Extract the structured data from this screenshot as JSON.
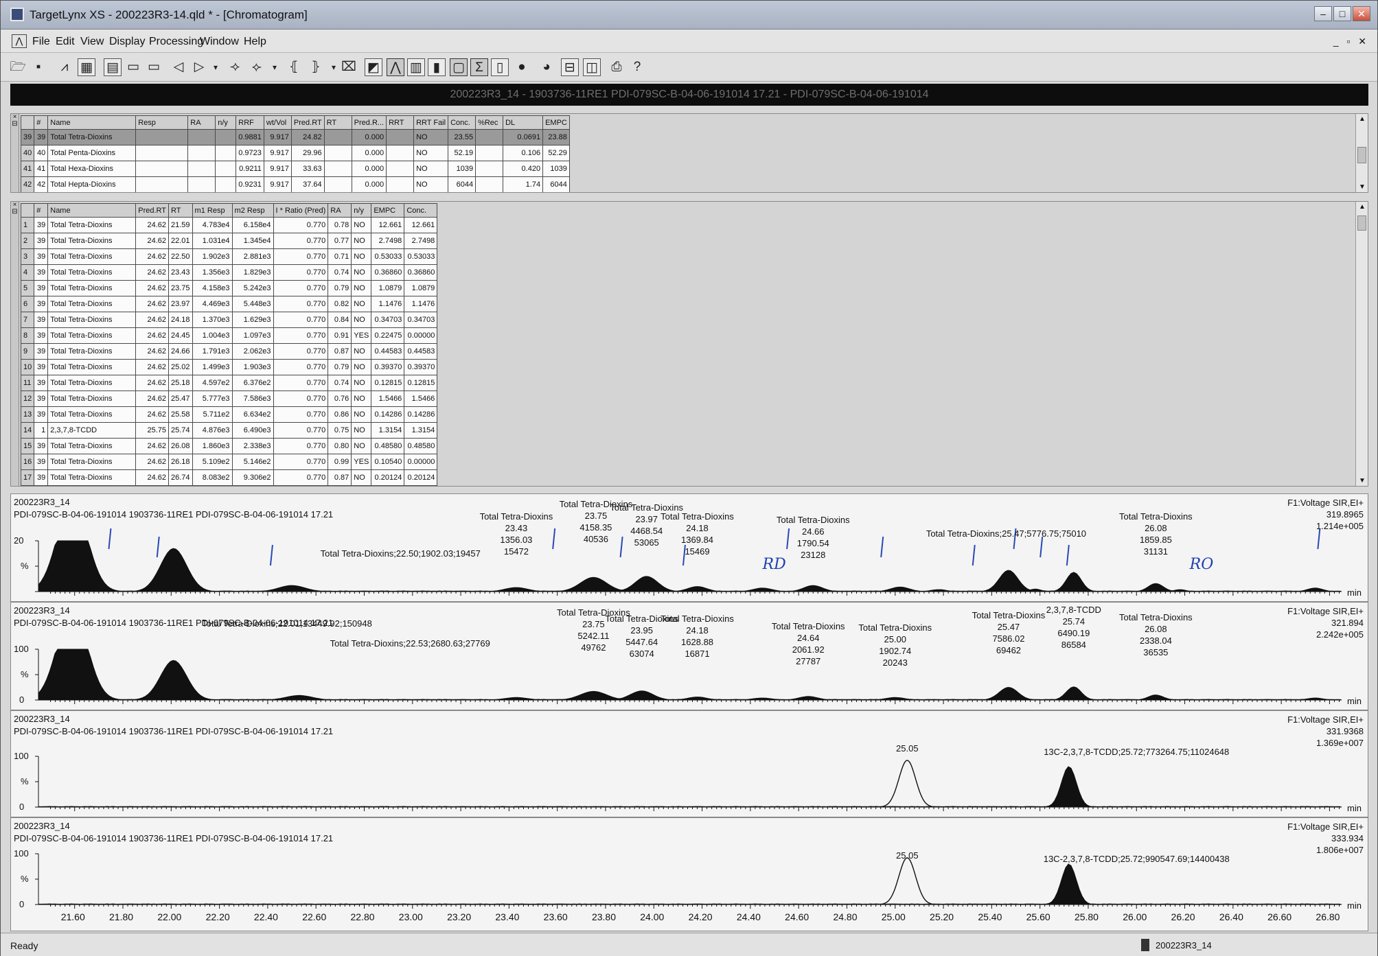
{
  "window": {
    "title": "TargetLynx XS - 200223R3-14.qld * - [Chromatogram]",
    "sample_header": "200223R3_14 - 1903736-11RE1 PDI-079SC-B-04-06-191014 17.21 - PDI-079SC-B-04-06-191014"
  },
  "menu": [
    "File",
    "Edit",
    "View",
    "Display",
    "Processing",
    "Window",
    "Help"
  ],
  "compound_table": {
    "columns": [
      "#",
      "Name",
      "Resp",
      "RA",
      "n/y",
      "RRF",
      "wt/Vol",
      "Pred.RT",
      "RT",
      "Pred.R...",
      "RRT",
      "RRT Fail",
      "Conc.",
      "%Rec",
      "DL",
      "EMPC"
    ],
    "rows": [
      {
        "rn": "39",
        "cells": [
          "39",
          "Total Tetra-Dioxins",
          "",
          "",
          "",
          "0.9881",
          "9.917",
          "24.82",
          "",
          "0.000",
          "",
          "NO",
          "23.55",
          "",
          "0.0691",
          "23.88"
        ]
      },
      {
        "rn": "40",
        "cells": [
          "40",
          "Total Penta-Dioxins",
          "",
          "",
          "",
          "0.9723",
          "9.917",
          "29.96",
          "",
          "0.000",
          "",
          "NO",
          "52.19",
          "",
          "0.106",
          "52.29"
        ]
      },
      {
        "rn": "41",
        "cells": [
          "41",
          "Total Hexa-Dioxins",
          "",
          "",
          "",
          "0.9211",
          "9.917",
          "33.63",
          "",
          "0.000",
          "",
          "NO",
          "1039",
          "",
          "0.420",
          "1039"
        ]
      },
      {
        "rn": "42",
        "cells": [
          "42",
          "Total Hepta-Dioxins",
          "",
          "",
          "",
          "0.9231",
          "9.917",
          "37.64",
          "",
          "0.000",
          "",
          "NO",
          "6044",
          "",
          "1.74",
          "6044"
        ]
      }
    ]
  },
  "peak_table": {
    "columns": [
      "#",
      "Name",
      "Pred.RT",
      "RT",
      "m1 Resp",
      "m2 Resp",
      "I * Ratio (Pred)",
      "RA",
      "n/y",
      "EMPC",
      "Conc."
    ],
    "rows": [
      {
        "rn": "1",
        "cells": [
          "39",
          "Total Tetra-Dioxins",
          "24.62",
          "21.59",
          "4.783e4",
          "6.158e4",
          "0.770",
          "0.78",
          "NO",
          "12.661",
          "12.661"
        ]
      },
      {
        "rn": "2",
        "cells": [
          "39",
          "Total Tetra-Dioxins",
          "24.62",
          "22.01",
          "1.031e4",
          "1.345e4",
          "0.770",
          "0.77",
          "NO",
          "2.7498",
          "2.7498"
        ]
      },
      {
        "rn": "3",
        "cells": [
          "39",
          "Total Tetra-Dioxins",
          "24.62",
          "22.50",
          "1.902e3",
          "2.881e3",
          "0.770",
          "0.71",
          "NO",
          "0.53033",
          "0.53033"
        ]
      },
      {
        "rn": "4",
        "cells": [
          "39",
          "Total Tetra-Dioxins",
          "24.62",
          "23.43",
          "1.356e3",
          "1.829e3",
          "0.770",
          "0.74",
          "NO",
          "0.36860",
          "0.36860"
        ]
      },
      {
        "rn": "5",
        "cells": [
          "39",
          "Total Tetra-Dioxins",
          "24.62",
          "23.75",
          "4.158e3",
          "5.242e3",
          "0.770",
          "0.79",
          "NO",
          "1.0879",
          "1.0879"
        ]
      },
      {
        "rn": "6",
        "cells": [
          "39",
          "Total Tetra-Dioxins",
          "24.62",
          "23.97",
          "4.469e3",
          "5.448e3",
          "0.770",
          "0.82",
          "NO",
          "1.1476",
          "1.1476"
        ]
      },
      {
        "rn": "7",
        "cells": [
          "39",
          "Total Tetra-Dioxins",
          "24.62",
          "24.18",
          "1.370e3",
          "1.629e3",
          "0.770",
          "0.84",
          "NO",
          "0.34703",
          "0.34703"
        ]
      },
      {
        "rn": "8",
        "cells": [
          "39",
          "Total Tetra-Dioxins",
          "24.62",
          "24.45",
          "1.004e3",
          "1.097e3",
          "0.770",
          "0.91",
          "YES",
          "0.22475",
          "0.00000"
        ]
      },
      {
        "rn": "9",
        "cells": [
          "39",
          "Total Tetra-Dioxins",
          "24.62",
          "24.66",
          "1.791e3",
          "2.062e3",
          "0.770",
          "0.87",
          "NO",
          "0.44583",
          "0.44583"
        ]
      },
      {
        "rn": "10",
        "cells": [
          "39",
          "Total Tetra-Dioxins",
          "24.62",
          "25.02",
          "1.499e3",
          "1.903e3",
          "0.770",
          "0.79",
          "NO",
          "0.39370",
          "0.39370"
        ]
      },
      {
        "rn": "11",
        "cells": [
          "39",
          "Total Tetra-Dioxins",
          "24.62",
          "25.18",
          "4.597e2",
          "6.376e2",
          "0.770",
          "0.74",
          "NO",
          "0.12815",
          "0.12815"
        ]
      },
      {
        "rn": "12",
        "cells": [
          "39",
          "Total Tetra-Dioxins",
          "24.62",
          "25.47",
          "5.777e3",
          "7.586e3",
          "0.770",
          "0.76",
          "NO",
          "1.5466",
          "1.5466"
        ]
      },
      {
        "rn": "13",
        "cells": [
          "39",
          "Total Tetra-Dioxins",
          "24.62",
          "25.58",
          "5.711e2",
          "6.634e2",
          "0.770",
          "0.86",
          "NO",
          "0.14286",
          "0.14286"
        ]
      },
      {
        "rn": "14",
        "cells": [
          "1",
          "2,3,7,8-TCDD",
          "25.75",
          "25.74",
          "4.876e3",
          "6.490e3",
          "0.770",
          "0.75",
          "NO",
          "1.3154",
          "1.3154"
        ]
      },
      {
        "rn": "15",
        "cells": [
          "39",
          "Total Tetra-Dioxins",
          "24.62",
          "26.08",
          "1.860e3",
          "2.338e3",
          "0.770",
          "0.80",
          "NO",
          "0.48580",
          "0.48580"
        ]
      },
      {
        "rn": "16",
        "cells": [
          "39",
          "Total Tetra-Dioxins",
          "24.62",
          "26.18",
          "5.109e2",
          "5.146e2",
          "0.770",
          "0.99",
          "YES",
          "0.10540",
          "0.00000"
        ]
      },
      {
        "rn": "17",
        "cells": [
          "39",
          "Total Tetra-Dioxins",
          "24.62",
          "26.74",
          "8.083e2",
          "9.306e2",
          "0.770",
          "0.87",
          "NO",
          "0.20124",
          "0.20124"
        ]
      }
    ]
  },
  "chart_data": [
    {
      "type": "line",
      "sample": "200223R3_14",
      "description_line": "PDI-079SC-B-04-06-191014 1903736-11RE1 PDI-079SC-B-04-06-191014 17.21",
      "function": "F1:Voltage SIR,EI+",
      "mass": "319.8965",
      "intensity": "1.214e+005",
      "y_tick": "20",
      "xlim": [
        21.45,
        26.85
      ],
      "peaks": [
        {
          "rt": 21.59,
          "height": 100,
          "width": 0.16,
          "flat": true
        },
        {
          "rt": 22.01,
          "height": 85,
          "width": 0.14
        },
        {
          "rt": 22.5,
          "height": 12,
          "width": 0.14
        },
        {
          "rt": 23.43,
          "height": 8,
          "width": 0.12
        },
        {
          "rt": 23.75,
          "height": 28,
          "width": 0.14
        },
        {
          "rt": 23.97,
          "height": 30,
          "width": 0.12
        },
        {
          "rt": 24.18,
          "height": 10,
          "width": 0.1
        },
        {
          "rt": 24.45,
          "height": 7,
          "width": 0.1
        },
        {
          "rt": 24.66,
          "height": 12,
          "width": 0.1
        },
        {
          "rt": 25.02,
          "height": 9,
          "width": 0.1
        },
        {
          "rt": 25.18,
          "height": 4,
          "width": 0.08
        },
        {
          "rt": 25.47,
          "height": 42,
          "width": 0.1
        },
        {
          "rt": 25.58,
          "height": 5,
          "width": 0.06
        },
        {
          "rt": 25.74,
          "height": 38,
          "width": 0.08
        },
        {
          "rt": 26.08,
          "height": 16,
          "width": 0.08
        },
        {
          "rt": 26.18,
          "height": 4,
          "width": 0.06
        },
        {
          "rt": 26.74,
          "height": 7,
          "width": 0.08
        }
      ],
      "annotations": [
        {
          "lines": [
            "Total Tetra-Dioxins;22.50;1902.03;19457"
          ],
          "rt": 22.95,
          "row": 4
        },
        {
          "lines": [
            "Total Tetra-Dioxins",
            "23.43",
            "1356.03",
            "15472"
          ],
          "rt": 23.43,
          "row": 1
        },
        {
          "lines": [
            "Total Tetra-Dioxins",
            "23.75",
            "4158.35",
            "40536"
          ],
          "rt": 23.76,
          "row": 0
        },
        {
          "lines": [
            "Total Tetra-Dioxins",
            "23.97",
            "4468.54",
            "53065"
          ],
          "rt": 23.97,
          "row": 0.3
        },
        {
          "lines": [
            "Total Tetra-Dioxins",
            "24.18",
            "1369.84",
            "15469"
          ],
          "rt": 24.18,
          "row": 1
        },
        {
          "lines": [
            "Total Tetra-Dioxins",
            "24.66",
            "1790.54",
            "23128"
          ],
          "rt": 24.66,
          "row": 1.3
        },
        {
          "lines": [
            "Total Tetra-Dioxins;25.47;5776.75;75010"
          ],
          "rt": 25.46,
          "row": 2.4
        },
        {
          "lines": [
            "Total Tetra-Dioxins",
            "26.08",
            "1859.85",
            "31131"
          ],
          "rt": 26.08,
          "row": 1
        }
      ],
      "handwriting": [
        {
          "text": "RD",
          "rt": 24.49
        },
        {
          "text": "RO",
          "rt": 26.26
        }
      ]
    },
    {
      "type": "line",
      "sample": "200223R3_14",
      "description_line": "PDI-079SC-B-04-06-191014 1903736-11RE1 PDI-079SC-B-04-06-191014 17.21",
      "function": "F1:Voltage SIR,EI+",
      "mass": "321.894",
      "intensity": "2.242e+005",
      "y_tick": "100",
      "xlim": [
        21.45,
        26.85
      ],
      "peaks": [
        {
          "rt": 21.59,
          "height": 100,
          "width": 0.16,
          "flat": true
        },
        {
          "rt": 22.01,
          "height": 78,
          "width": 0.14
        },
        {
          "rt": 22.53,
          "height": 9,
          "width": 0.14
        },
        {
          "rt": 23.43,
          "height": 5,
          "width": 0.12
        },
        {
          "rt": 23.75,
          "height": 17,
          "width": 0.14
        },
        {
          "rt": 23.95,
          "height": 18,
          "width": 0.12
        },
        {
          "rt": 24.18,
          "height": 6,
          "width": 0.1
        },
        {
          "rt": 24.45,
          "height": 4,
          "width": 0.1
        },
        {
          "rt": 24.64,
          "height": 7,
          "width": 0.1
        },
        {
          "rt": 25.0,
          "height": 5,
          "width": 0.1
        },
        {
          "rt": 25.47,
          "height": 25,
          "width": 0.1
        },
        {
          "rt": 25.74,
          "height": 26,
          "width": 0.08
        },
        {
          "rt": 26.08,
          "height": 10,
          "width": 0.08
        },
        {
          "rt": 26.74,
          "height": 4,
          "width": 0.08
        }
      ],
      "annotations": [
        {
          "lines": [
            "Total Tetra-Dioxins;22.01;13449.92;150948"
          ],
          "rt": 22.48,
          "row": 0.9
        },
        {
          "lines": [
            "Total Tetra-Dioxins;22.53;2680.63;27769"
          ],
          "rt": 22.99,
          "row": 2.5
        },
        {
          "lines": [
            "Total Tetra-Dioxins",
            "23.75",
            "5242.11",
            "49762"
          ],
          "rt": 23.75,
          "row": 0
        },
        {
          "lines": [
            "Total Tetra-Dioxins",
            "23.95",
            "5447.64",
            "63074"
          ],
          "rt": 23.95,
          "row": 0.5
        },
        {
          "lines": [
            "Total Tetra-Dioxins",
            "24.18",
            "1628.88",
            "16871"
          ],
          "rt": 24.18,
          "row": 0.5
        },
        {
          "lines": [
            "Total Tetra-Dioxins",
            "24.64",
            "2061.92",
            "27787"
          ],
          "rt": 24.64,
          "row": 1.1
        },
        {
          "lines": [
            "Total Tetra-Dioxins",
            "25.00",
            "1902.74",
            "20243"
          ],
          "rt": 25.0,
          "row": 1.2
        },
        {
          "lines": [
            "Total Tetra-Dioxins",
            "25.47",
            "7586.02",
            "69462"
          ],
          "rt": 25.47,
          "row": 0.2
        },
        {
          "lines": [
            "2,3,7,8-TCDD",
            "25.74",
            "6490.19",
            "86584"
          ],
          "rt": 25.74,
          "row": -0.2
        },
        {
          "lines": [
            "Total Tetra-Dioxins",
            "26.08",
            "2338.04",
            "36535"
          ],
          "rt": 26.08,
          "row": 0.4
        }
      ],
      "handwriting": []
    },
    {
      "type": "line",
      "sample": "200223R3_14",
      "description_line": "PDI-079SC-B-04-06-191014 1903736-11RE1 PDI-079SC-B-04-06-191014 17.21",
      "function": "F1:Voltage SIR,EI+",
      "mass": "331.9368",
      "intensity": "1.369e+007",
      "y_tick": "100",
      "xlim": [
        21.45,
        26.85
      ],
      "peaks": [
        {
          "rt": 25.05,
          "height": 92,
          "width": 0.09,
          "outline": true
        },
        {
          "rt": 25.72,
          "height": 80,
          "width": 0.08
        }
      ],
      "annotations": [
        {
          "lines": [
            "25.05"
          ],
          "rt": 25.05,
          "row": 2.2
        },
        {
          "lines": [
            "13C-2,3,7,8-TCDD;25.72;773264.75;11024648"
          ],
          "rt": 26.0,
          "row": 2.5
        }
      ],
      "handwriting": []
    },
    {
      "type": "line",
      "sample": "200223R3_14",
      "description_line": "PDI-079SC-B-04-06-191014 1903736-11RE1 PDI-079SC-B-04-06-191014 17.21",
      "function": "F1:Voltage SIR,EI+",
      "mass": "333.934",
      "intensity": "1.806e+007",
      "y_tick": "100",
      "xlim": [
        21.45,
        26.85
      ],
      "peaks": [
        {
          "rt": 25.05,
          "height": 92,
          "width": 0.09,
          "outline": true
        },
        {
          "rt": 25.72,
          "height": 80,
          "width": 0.08
        }
      ],
      "annotations": [
        {
          "lines": [
            "25.05"
          ],
          "rt": 25.05,
          "row": 2.2
        },
        {
          "lines": [
            "13C-2,3,7,8-TCDD;25.72;990547.69;14400438"
          ],
          "rt": 26.0,
          "row": 2.5
        }
      ],
      "handwriting": []
    }
  ],
  "x_axis": {
    "ticks": [
      "21.60",
      "21.80",
      "22.00",
      "22.20",
      "22.40",
      "22.60",
      "22.80",
      "23.00",
      "23.20",
      "23.40",
      "23.60",
      "23.80",
      "24.00",
      "24.20",
      "24.40",
      "24.60",
      "24.80",
      "25.00",
      "25.20",
      "25.40",
      "25.60",
      "25.80",
      "26.00",
      "26.20",
      "26.40",
      "26.60",
      "26.80"
    ],
    "unit": "min",
    "y_pct": "%",
    "y_zero": "0"
  },
  "status": {
    "text": "Ready",
    "file": "200223R3_14"
  }
}
